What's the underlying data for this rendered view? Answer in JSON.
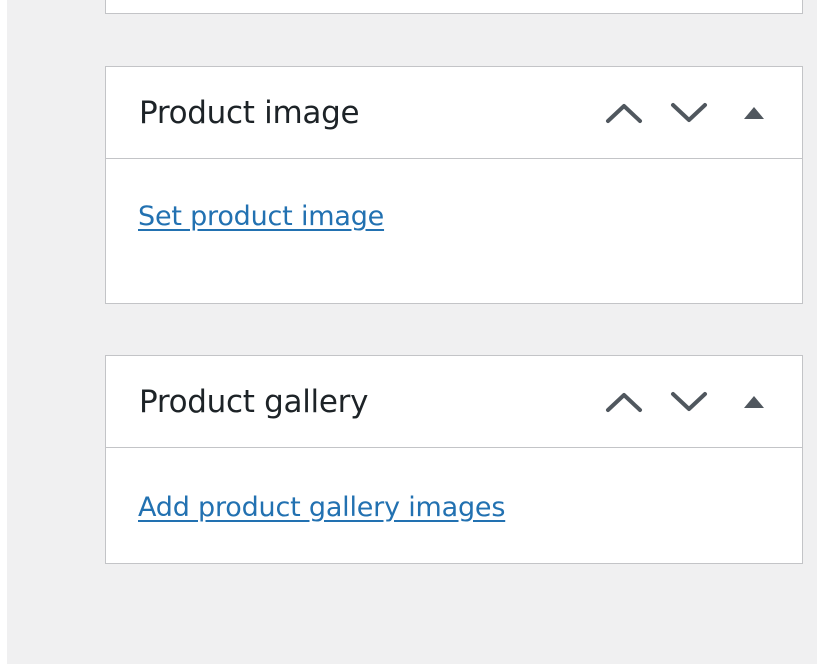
{
  "panels": [
    {
      "title": "Product image",
      "link": "Set product image",
      "controls": [
        "move-up-icon",
        "move-down-icon",
        "toggle-panel-icon"
      ]
    },
    {
      "title": "Product gallery",
      "link": "Add product gallery images",
      "controls": [
        "move-up-icon",
        "move-down-icon",
        "toggle-panel-icon"
      ]
    }
  ],
  "colors": {
    "background": "#f0f0f1",
    "panel_border": "#c3c4c7",
    "title_text": "#1d2327",
    "link": "#2271b1",
    "icon": "#50575e"
  }
}
